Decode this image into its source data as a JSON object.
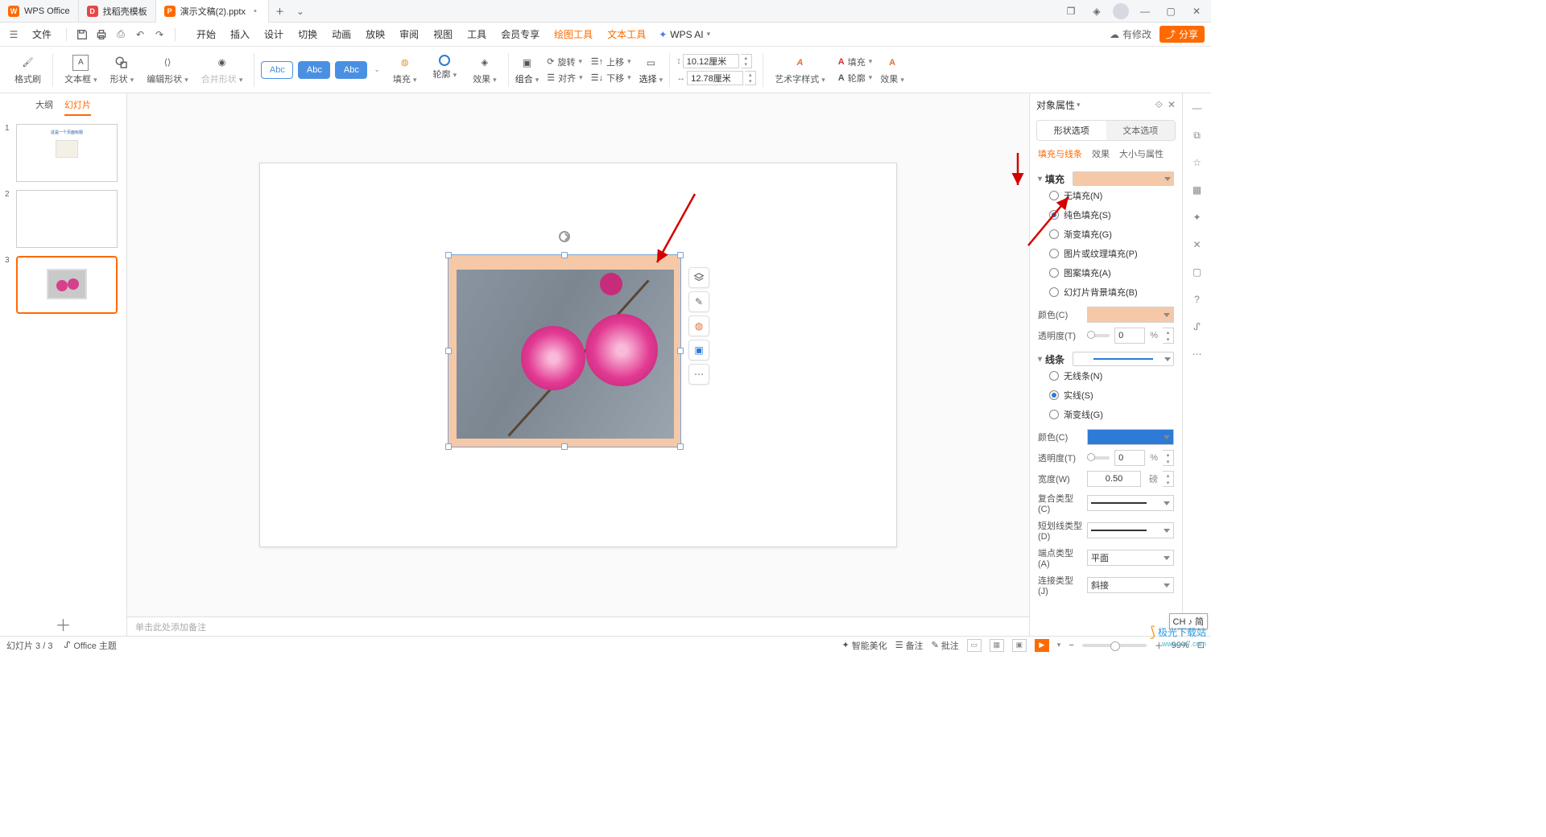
{
  "app": {
    "name": "WPS Office",
    "tab_template": "找稻壳模板",
    "doc_name": "演示文稿(2).pptx"
  },
  "menubar": {
    "file": "文件",
    "tabs": [
      "开始",
      "插入",
      "设计",
      "切换",
      "动画",
      "放映",
      "审阅",
      "视图",
      "工具",
      "会员专享",
      "绘图工具",
      "文本工具"
    ],
    "active_tabs": [
      "绘图工具",
      "文本工具"
    ],
    "wps_ai": "WPS AI",
    "has_changes": "有修改",
    "share": "分享"
  },
  "ribbon": {
    "format_painter": "格式刷",
    "textbox": "文本框",
    "shape": "形状",
    "edit_shape": "编辑形状",
    "merge_shape": "合并形状",
    "abc": "Abc",
    "fill": "填充",
    "outline": "轮廓",
    "effect": "效果",
    "group": "组合",
    "rotate": "旋转",
    "align": "对齐",
    "up": "上移",
    "down": "下移",
    "select": "选择",
    "height": "10.12厘米",
    "width": "12.78厘米",
    "art_style": "艺术字样式",
    "fill2": "填充",
    "outline2": "轮廓",
    "effect2": "效果"
  },
  "outline": {
    "tab_outline": "大纲",
    "tab_slides": "幻灯片"
  },
  "notes": "单击此处添加备注",
  "panel": {
    "title": "对象属性",
    "seg_shape": "形状选项",
    "seg_text": "文本选项",
    "sub_fill_line": "填充与线条",
    "sub_effect": "效果",
    "sub_size": "大小与属性",
    "fill": {
      "title": "填充",
      "opt_none": "无填充(N)",
      "opt_solid": "纯色填充(S)",
      "opt_gradient": "渐变填充(G)",
      "opt_picture": "图片或纹理填充(P)",
      "opt_pattern": "图案填充(A)",
      "opt_slide_bg": "幻灯片背景填充(B)",
      "color_label": "颜色(C)",
      "transparency_label": "透明度(T)",
      "transparency_value": "0",
      "transparency_unit": "%",
      "fill_color": "#f5c9a8"
    },
    "line": {
      "title": "线条",
      "opt_none": "无线条(N)",
      "opt_solid": "实线(S)",
      "opt_gradient": "渐变线(G)",
      "color_label": "颜色(C)",
      "line_color": "#2d7bd6",
      "transparency_label": "透明度(T)",
      "transparency_value": "0",
      "transparency_unit": "%",
      "width_label": "宽度(W)",
      "width_value": "0.50",
      "width_unit": "磅",
      "compound_label": "复合类型(C)",
      "dash_label": "短划线类型(D)",
      "cap_label": "端点类型(A)",
      "cap_value": "平面",
      "join_label": "连接类型(J)",
      "join_value": "斜接"
    }
  },
  "status": {
    "slide_info": "幻灯片 3 / 3",
    "theme": "Office 主题",
    "beautify": "智能美化",
    "notes": "备注",
    "comments": "批注",
    "zoom": "99%"
  },
  "ime": "CH ♪ 简",
  "watermark": {
    "main": "极光下载站",
    "sub": "www.xz7.com"
  }
}
